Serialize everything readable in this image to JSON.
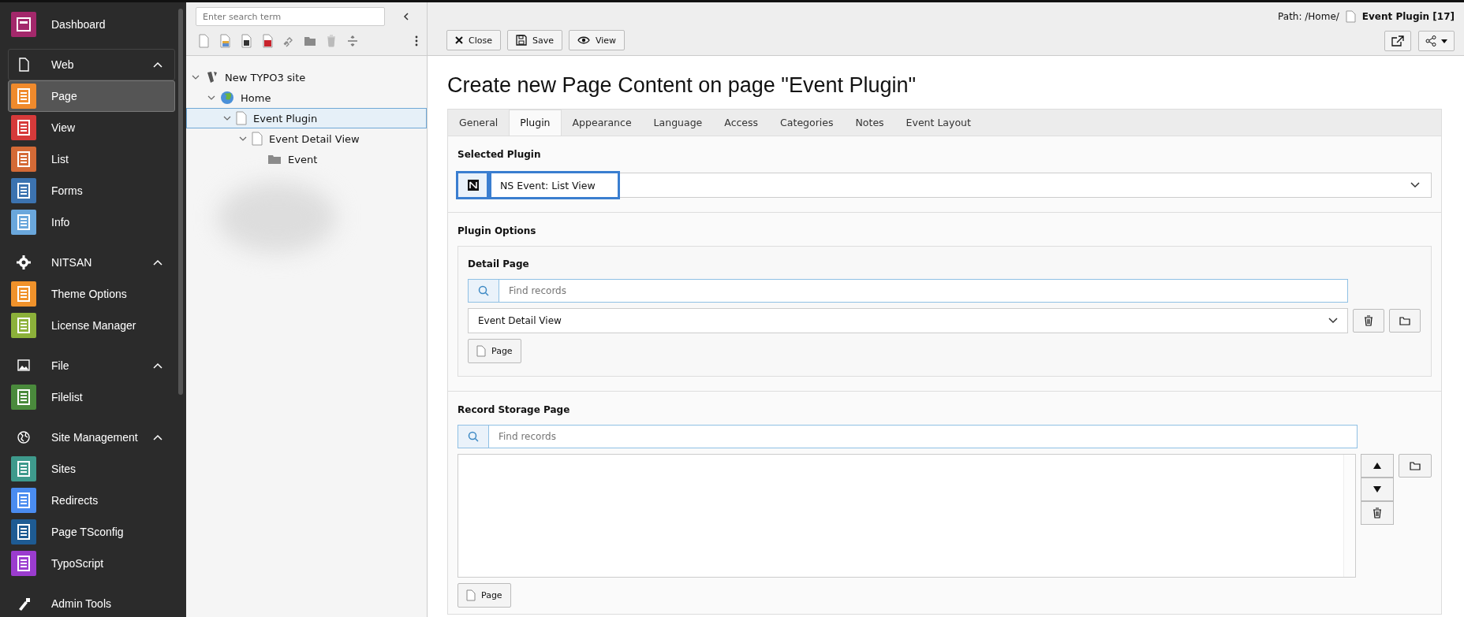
{
  "sidebar": {
    "entries": [
      {
        "kind": "module",
        "label": "Dashboard",
        "selected": false,
        "color": "#a3286b"
      },
      {
        "kind": "group",
        "label": "Web",
        "expanded": true,
        "children": [
          {
            "label": "Page",
            "selected": true,
            "color": "#f08a2c"
          },
          {
            "label": "View",
            "selected": false,
            "color": "#d63a3a"
          },
          {
            "label": "List",
            "selected": false,
            "color": "#d46a36"
          },
          {
            "label": "Forms",
            "selected": false,
            "color": "#3c73b0"
          },
          {
            "label": "Info",
            "selected": false,
            "color": "#6aa7dc"
          }
        ]
      },
      {
        "kind": "group",
        "label": "NITSAN",
        "expanded": true,
        "children": [
          {
            "label": "Theme Options",
            "selected": false,
            "color": "#f0922b"
          },
          {
            "label": "License Manager",
            "selected": false,
            "color": "#8cb13a"
          }
        ]
      },
      {
        "kind": "group",
        "label": "File",
        "expanded": true,
        "children": [
          {
            "label": "Filelist",
            "selected": false,
            "color": "#4a8a3c"
          }
        ]
      },
      {
        "kind": "group",
        "label": "Site Management",
        "expanded": true,
        "children": [
          {
            "label": "Sites",
            "selected": false,
            "color": "#3e9a8c"
          },
          {
            "label": "Redirects",
            "selected": false,
            "color": "#4a8cf0"
          },
          {
            "label": "Page TSconfig",
            "selected": false,
            "color": "#1e5b93"
          },
          {
            "label": "TypoScript",
            "selected": false,
            "color": "#9b3ccf"
          }
        ]
      },
      {
        "kind": "group",
        "label": "Admin Tools"
      }
    ]
  },
  "page_tree": {
    "search": {
      "placeholder": "Enter search term"
    },
    "nodes": [
      {
        "kind": "site",
        "label": "New TYPO3 site",
        "expanded": true,
        "selected": false,
        "children": [
          {
            "kind": "globe",
            "label": "Home",
            "expanded": true,
            "selected": false,
            "children": [
              {
                "kind": "page",
                "label": "Event Plugin",
                "expanded": true,
                "selected": true,
                "children": [
                  {
                    "kind": "page",
                    "label": "Event Detail View",
                    "expanded": true,
                    "selected": false,
                    "children": [
                      {
                        "kind": "folder",
                        "label": "Event",
                        "selected": false
                      }
                    ]
                  }
                ]
              }
            ]
          }
        ]
      }
    ]
  },
  "doc_header": {
    "path_label": "Path: /Home/",
    "page_title": "Event Plugin [17]",
    "buttons": [
      "Close",
      "Save",
      "View"
    ]
  },
  "heading": "Create new Page Content on page \"Event Plugin\"",
  "tabs": [
    {
      "label": "General",
      "selected": false
    },
    {
      "label": "Plugin",
      "selected": true
    },
    {
      "label": "Appearance",
      "selected": false
    },
    {
      "label": "Language",
      "selected": false
    },
    {
      "label": "Access",
      "selected": false
    },
    {
      "label": "Categories",
      "selected": false
    },
    {
      "label": "Notes",
      "selected": false
    },
    {
      "label": "Event Layout",
      "selected": false
    }
  ],
  "selected_plugin": {
    "label": "Selected Plugin",
    "value": "NS Event: List View"
  },
  "plugin_options": {
    "label": "Plugin Options",
    "detail_page": {
      "label": "Detail Page",
      "search_placeholder": "Find records",
      "value": "Event Detail View",
      "add_button": "Page"
    }
  },
  "record_storage_page": {
    "label": "Record Storage Page",
    "search_placeholder": "Find records",
    "add_button": "Page"
  }
}
